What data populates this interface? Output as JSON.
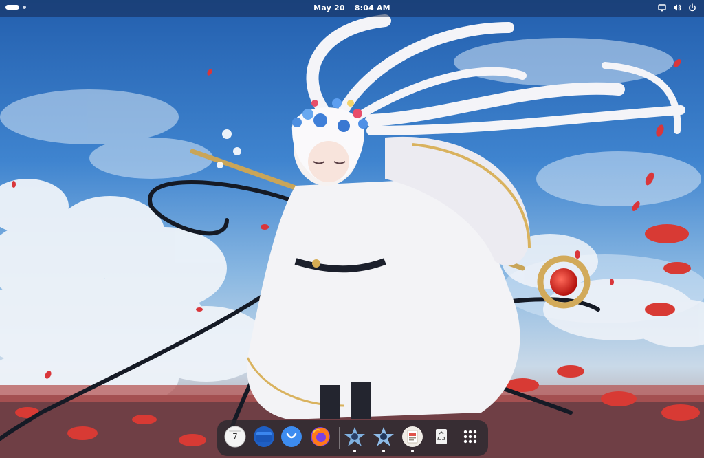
{
  "topbar": {
    "date": "May 20",
    "time": "8:04 AM",
    "icons": [
      "screen-icon",
      "volume-icon",
      "power-icon"
    ]
  },
  "dock": {
    "apps": [
      {
        "name": "calendar",
        "icon": "calendar-icon",
        "badge_text": "7"
      },
      {
        "name": "files",
        "icon": "folder-icon"
      },
      {
        "name": "software",
        "icon": "shopping-bag-icon"
      },
      {
        "name": "firefox",
        "icon": "firefox-icon"
      },
      {
        "name": "wallpaper-app-1",
        "icon": "anime-character-icon",
        "running": true
      },
      {
        "name": "wallpaper-app-2",
        "icon": "anime-character-icon",
        "running": true
      },
      {
        "name": "document-viewer",
        "icon": "document-icon",
        "running": true
      },
      {
        "name": "recycle",
        "icon": "recycle-icon"
      },
      {
        "name": "app-grid",
        "icon": "grid-icon"
      }
    ]
  },
  "colors": {
    "topbar_bg": "#1f3560",
    "dock_bg": "#28282e",
    "files_blue": "#2b6fd6",
    "bag_blue": "#3d8cf0",
    "firefox_orange": "#ff7a1a",
    "firefox_purple": "#7b3fe4",
    "flower_red": "#e0342e"
  }
}
